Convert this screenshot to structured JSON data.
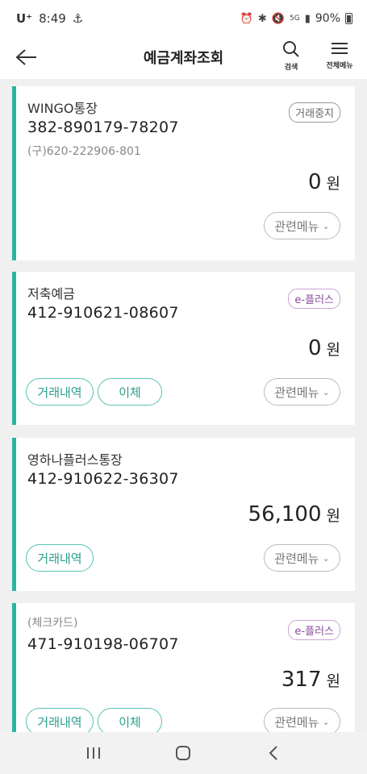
{
  "status_bar": {
    "carrier": "U⁺",
    "time": "8:49",
    "battery": "90%",
    "icons": [
      "alarm-icon",
      "bluetooth-icon",
      "mute-icon",
      "5g-icon",
      "signal-icon"
    ]
  },
  "header": {
    "title": "예금계좌조회",
    "search_label": "검색",
    "menu_label": "전체메뉴"
  },
  "accounts": [
    {
      "name": "WINGO통장",
      "number": "382-890179-78207",
      "old_number": "(구)620-222906-801",
      "badge": "거래중지",
      "balance": "0",
      "currency": "원",
      "related_label": "관련메뉴"
    },
    {
      "name": "저축예금",
      "number": "412-910621-08607",
      "badge": "e-플러스",
      "balance": "0",
      "currency": "원",
      "history_label": "거래내역",
      "transfer_label": "이체",
      "related_label": "관련메뉴"
    },
    {
      "name": "영하나플러스통장",
      "number": "412-910622-36307",
      "balance": "56,100",
      "currency": "원",
      "history_label": "거래내역",
      "related_label": "관련메뉴"
    },
    {
      "name": "(체크카드)",
      "number": "471-910198-06707",
      "badge": "e-플러스",
      "balance": "317",
      "currency": "원",
      "history_label": "거래내역",
      "transfer_label": "이체",
      "related_label": "관련메뉴"
    }
  ],
  "colors": {
    "accent": "#2bb5a1",
    "badge_plus": "#8a4a9e",
    "background": "#f0f0f0"
  }
}
